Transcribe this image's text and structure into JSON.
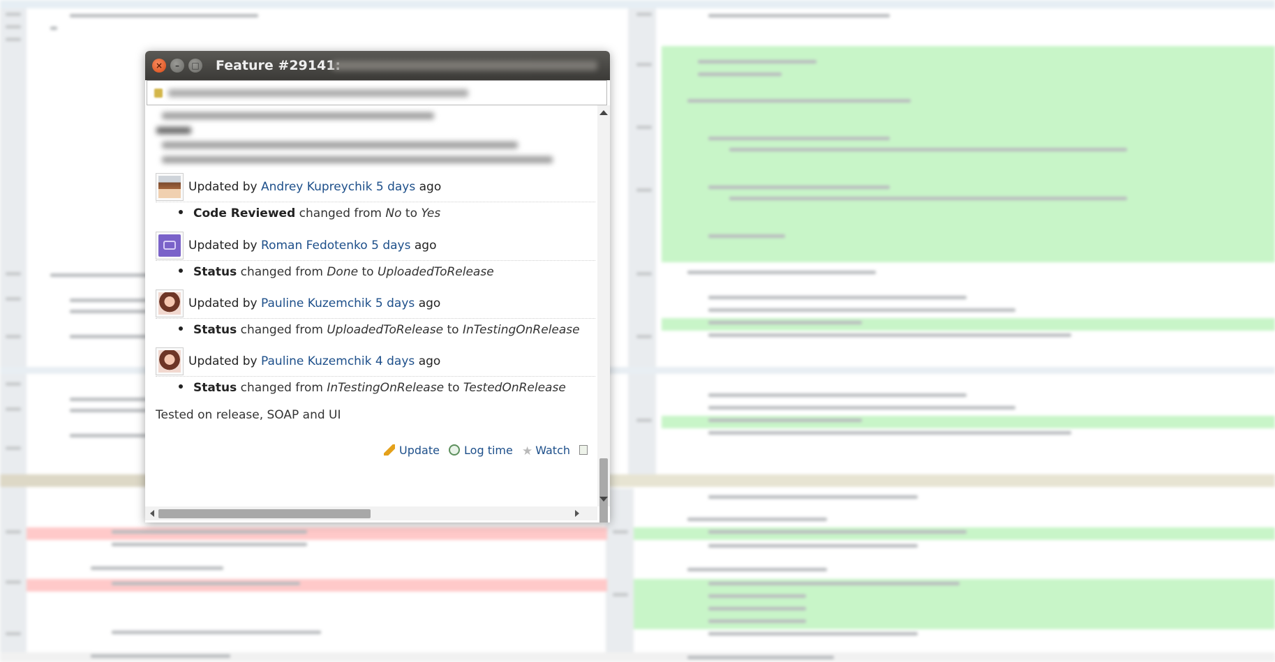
{
  "window": {
    "title": "Feature #29141:"
  },
  "journal": [
    {
      "avatar": "andrey-avatar",
      "prefix": "Updated by",
      "user": "Andrey Kupreychik",
      "when": "5 days",
      "suffix": "ago",
      "detail": {
        "field": "Code Reviewed",
        "changed": "changed from",
        "from": "No",
        "to_word": "to",
        "to": "Yes"
      }
    },
    {
      "avatar": "roman-avatar",
      "prefix": "Updated by",
      "user": "Roman Fedotenko",
      "when": "5 days",
      "suffix": "ago",
      "detail": {
        "field": "Status",
        "changed": "changed from",
        "from": "Done",
        "to_word": "to",
        "to": "UploadedToRelease"
      }
    },
    {
      "avatar": "pauline-avatar",
      "prefix": "Updated by",
      "user": "Pauline Kuzemchik",
      "when": "5 days",
      "suffix": "ago",
      "detail": {
        "field": "Status",
        "changed": "changed from",
        "from": "UploadedToRelease",
        "to_word": "to",
        "to": "InTestingOnRelease"
      }
    },
    {
      "avatar": "pauline-avatar",
      "prefix": "Updated by",
      "user": "Pauline Kuzemchik",
      "when": "4 days",
      "suffix": "ago",
      "detail": {
        "field": "Status",
        "changed": "changed from",
        "from": "InTestingOnRelease",
        "to_word": "to",
        "to": "TestedOnRelease"
      }
    }
  ],
  "note": "Tested on release, SOAP and UI",
  "actions": {
    "update": "Update",
    "log_time": "Log time",
    "watch": "Watch"
  },
  "colors": {
    "link": "#1d4f8a",
    "added_line": "#c9f7c9",
    "removed_line": "#ffc4c4",
    "titlebar": "#3b3a37"
  }
}
